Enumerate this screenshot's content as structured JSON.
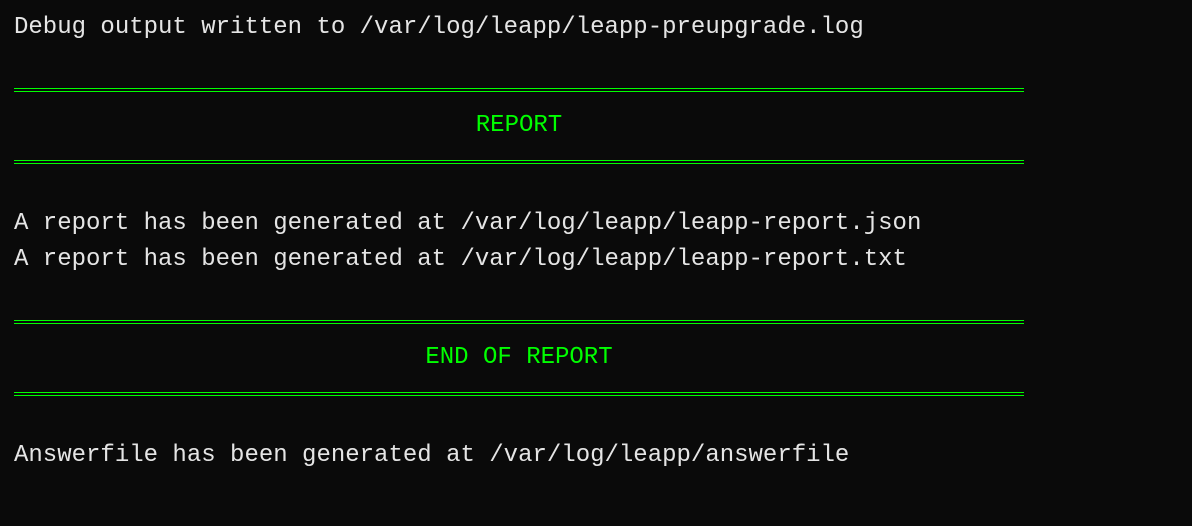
{
  "terminal": {
    "debug_line": "Debug output written to /var/log/leapp/leapp-preupgrade.log",
    "report_header": "REPORT",
    "report_lines": {
      "json": "A report has been generated at /var/log/leapp/leapp-report.json",
      "txt": "A report has been generated at /var/log/leapp/leapp-report.txt"
    },
    "end_report_header": "END OF REPORT",
    "answerfile_line": "Answerfile has been generated at /var/log/leapp/answerfile"
  }
}
